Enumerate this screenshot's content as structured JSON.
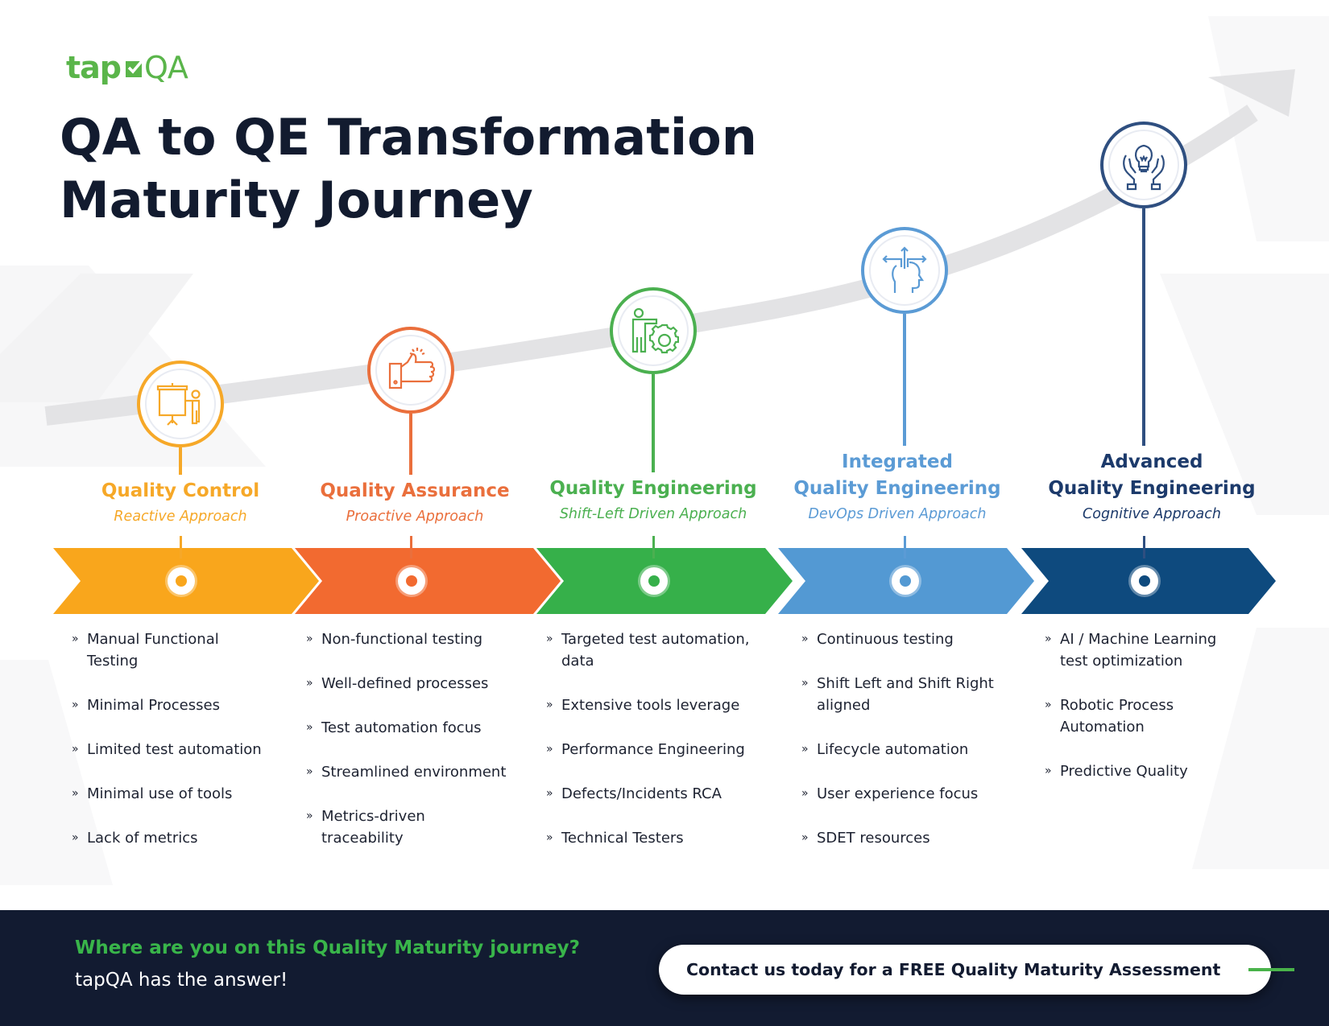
{
  "brand": {
    "logo_left": "tap",
    "logo_right": "QA",
    "logo_icon": "checkbox-check-icon"
  },
  "header": {
    "title_line1": "QA to QE Transformation",
    "title_line2": "Maturity Journey"
  },
  "colors": {
    "title": "#121b2f",
    "trend_arrow": "#e3e3e5",
    "footer_bg": "#121b31",
    "footer_question": "#39b54a",
    "cta_accent": "#49b34a"
  },
  "stages": [
    {
      "id": "quality-control",
      "pre_title": "",
      "title": "Quality Control",
      "subtitle": "Reactive Approach",
      "icon": "presentation-icon",
      "color": "#f6a828",
      "band_color": "#f9a61c",
      "items": [
        "Manual Functional Testing",
        "Minimal Processes",
        "Limited test automation",
        "Minimal use of tools",
        "Lack of metrics"
      ]
    },
    {
      "id": "quality-assurance",
      "pre_title": "",
      "title": "Quality Assurance",
      "subtitle": "Proactive Approach",
      "icon": "thumbs-up-icon",
      "color": "#ea6f3c",
      "band_color": "#f26a30",
      "items": [
        "Non-functional testing",
        "Well-defined processes",
        "Test automation focus",
        "Streamlined environment",
        "Metrics-driven traceability"
      ]
    },
    {
      "id": "quality-engineering",
      "pre_title": "",
      "title": "Quality Engineering",
      "subtitle": "Shift-Left Driven Approach",
      "icon": "person-gear-icon",
      "color": "#4bb050",
      "band_color": "#36b04a",
      "items": [
        "Targeted test automation, data",
        "Extensive tools leverage",
        "Performance Engineering",
        "Defects/Incidents RCA",
        "Technical Testers"
      ]
    },
    {
      "id": "integrated-quality-engineering",
      "pre_title": "Integrated",
      "title": "Quality Engineering",
      "subtitle": "DevOps Driven Approach",
      "icon": "head-arrows-icon",
      "color": "#5b9bd5",
      "band_color": "#5399d3",
      "items": [
        "Continuous testing",
        "Shift Left and Shift Right aligned",
        "Lifecycle automation",
        "User experience focus",
        "SDET resources"
      ]
    },
    {
      "id": "advanced-quality-engineering",
      "pre_title": "Advanced",
      "title": "Quality Engineering",
      "subtitle": "Cognitive Approach",
      "icon": "hands-lightbulb-icon",
      "color": "#2f4f80",
      "band_color": "#0e4a7e",
      "items": [
        "AI / Machine Learning test optimization",
        "Robotic Process Automation",
        "Predictive Quality"
      ]
    }
  ],
  "list_bullet": "»",
  "footer": {
    "question": "Where are you on this Quality Maturity journey?",
    "answer": "tapQA has the answer!",
    "cta_label": "Contact us today for a FREE Quality Maturity Assessment"
  }
}
